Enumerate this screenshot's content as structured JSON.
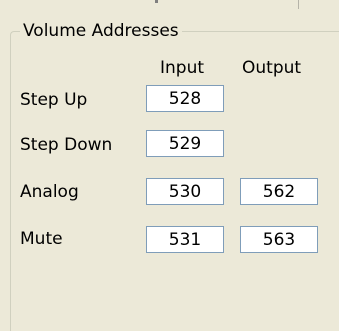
{
  "group": {
    "legend": "Volume Addresses",
    "col_input": "Input",
    "col_output": "Output"
  },
  "rows": [
    {
      "label": "Step Up",
      "input": "528",
      "output": null
    },
    {
      "label": "Step Down",
      "input": "529",
      "output": null
    },
    {
      "label": "Analog",
      "input": "530",
      "output": "562"
    },
    {
      "label": "Mute",
      "input": "531",
      "output": "563"
    }
  ]
}
